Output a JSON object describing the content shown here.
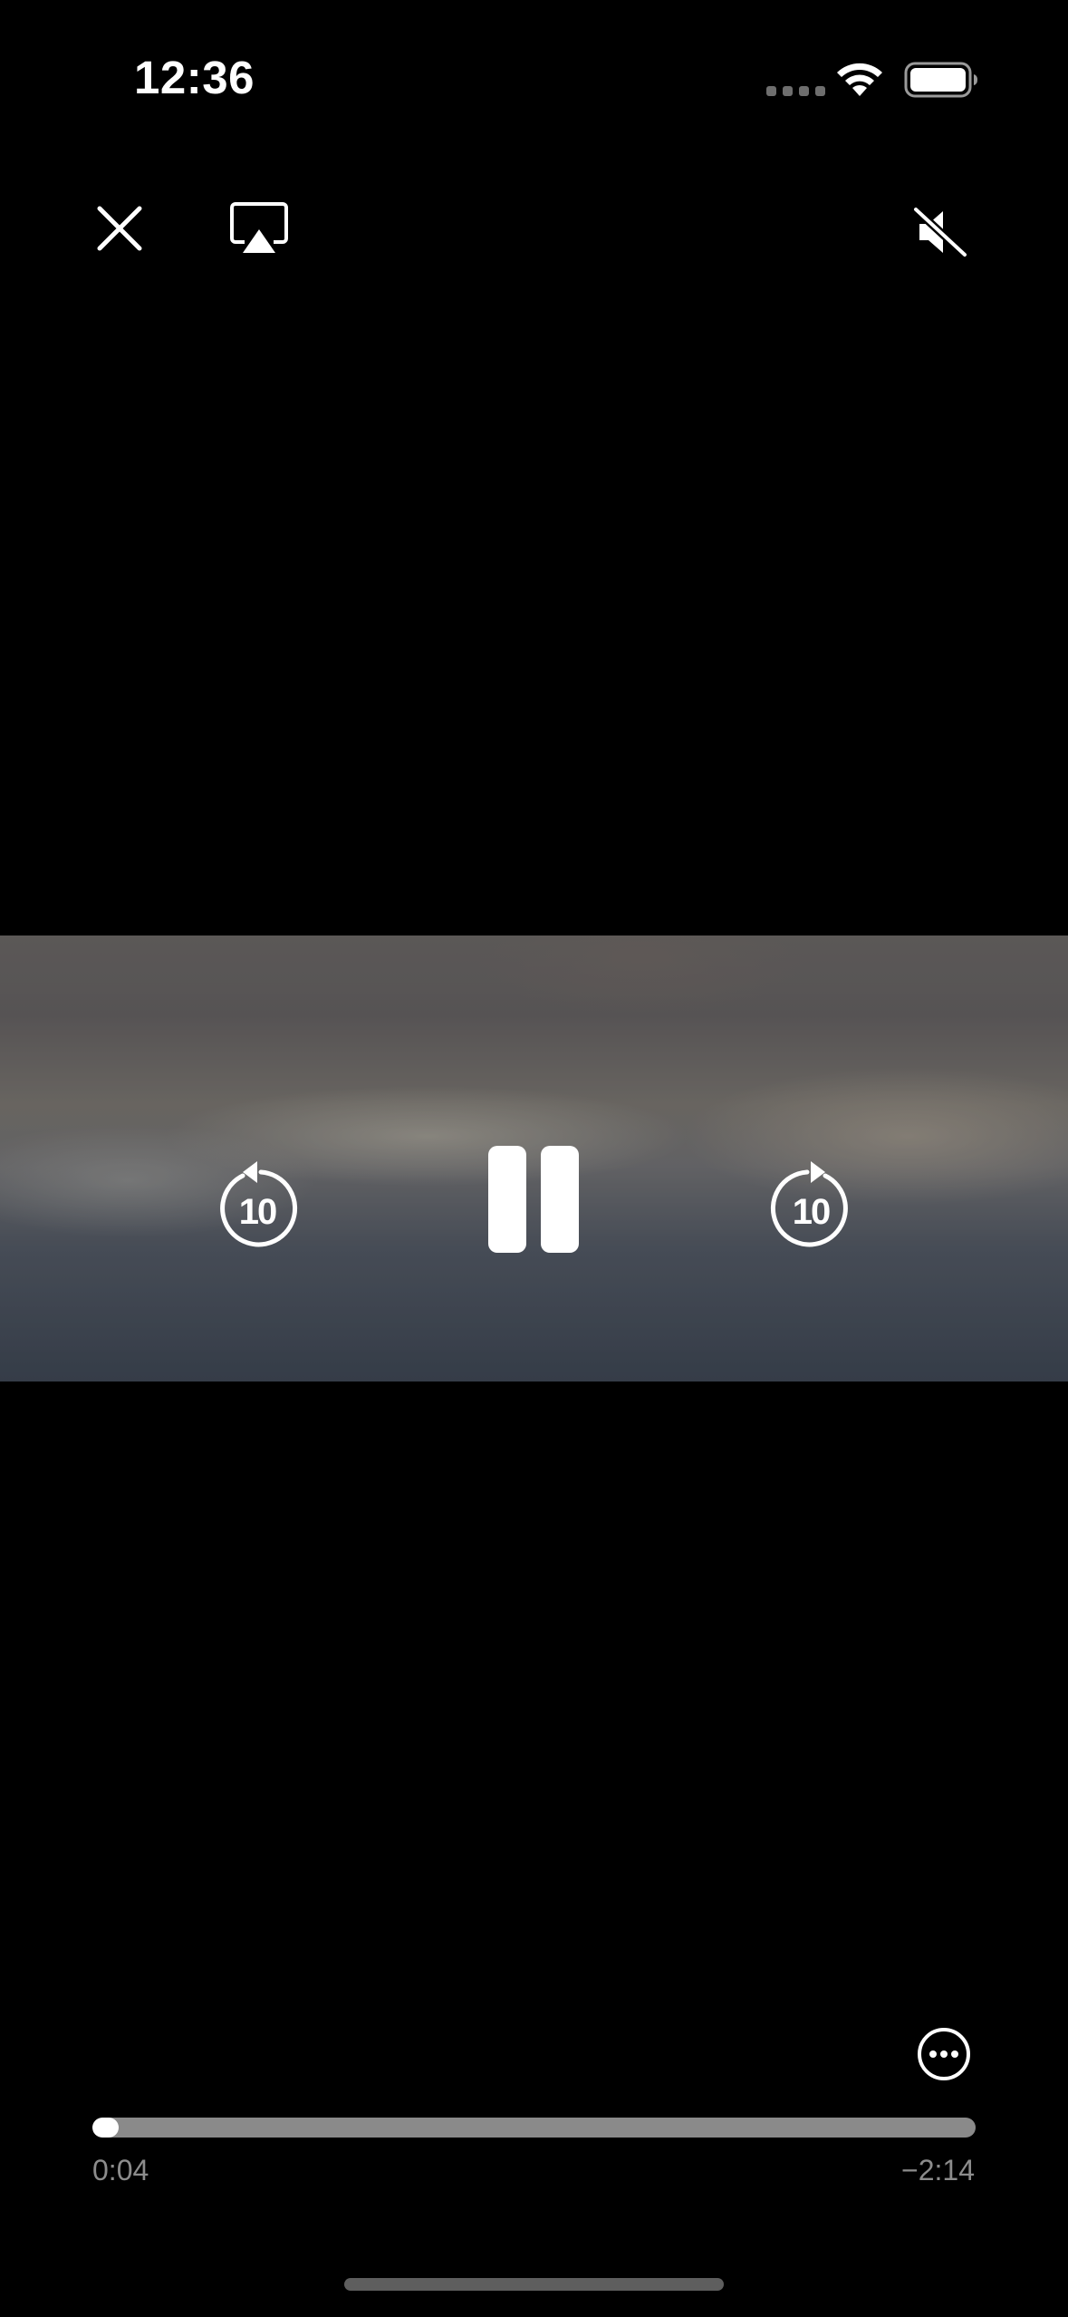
{
  "status_bar": {
    "time": "12:36",
    "wifi_icon": "wifi-icon",
    "battery_icon": "battery-icon"
  },
  "top_controls": {
    "close_icon": "close-icon",
    "airplay_icon": "airplay-icon",
    "mute_icon": "speaker-muted-icon"
  },
  "playback": {
    "skip_back_label": "10",
    "skip_back_icon": "rotate-back-icon",
    "pause_icon": "pause-icon",
    "skip_forward_label": "10",
    "skip_forward_icon": "rotate-forward-icon"
  },
  "scrubber": {
    "elapsed": "0:04",
    "remaining": "−2:14",
    "progress_fraction": 0.03
  },
  "more_icon": "ellipsis-circle-icon",
  "colors": {
    "background": "#000000",
    "controls": "#ffffff",
    "track": "#8a8a8a",
    "time_text": "#8c8c8c"
  }
}
